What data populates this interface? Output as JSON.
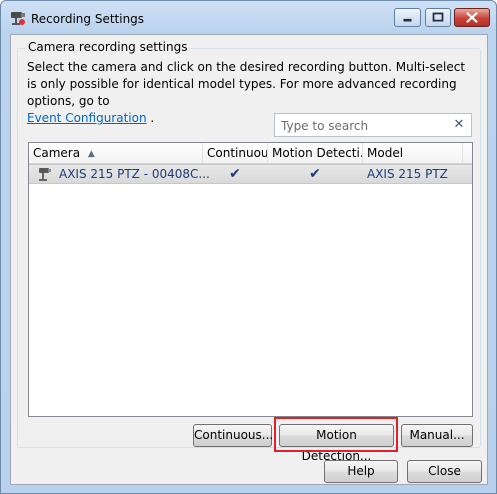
{
  "window": {
    "title": "Recording Settings",
    "controls": {
      "minimize": "minimize",
      "maximize": "maximize",
      "close": "close"
    }
  },
  "group": {
    "title": "Camera recording settings",
    "description": "Select the camera and click on the desired recording button. Multi-select is only possible for identical model types. For more advanced recording options, go to",
    "link_text": "Event Configuration",
    "trailing": "."
  },
  "search": {
    "placeholder": "Type to search",
    "value": "",
    "clear_glyph": "✕"
  },
  "table": {
    "columns": [
      "Camera",
      "Continuous",
      "Motion Detecti...",
      "Model"
    ],
    "sort_indicator": "▲",
    "rows": [
      {
        "camera": "AXIS 215 PTZ - 00408C...",
        "continuous": "✔",
        "motion_detection": "✔",
        "model": "AXIS 215 PTZ"
      }
    ]
  },
  "buttons": {
    "continuous": "Continuous...",
    "motion_detection": "Motion Detection...",
    "manual": "Manual...",
    "help": "Help",
    "close": "Close"
  },
  "colors": {
    "highlight": "#e0202a",
    "link": "#0066cc",
    "selected_row_text": "#1a3c7a"
  }
}
